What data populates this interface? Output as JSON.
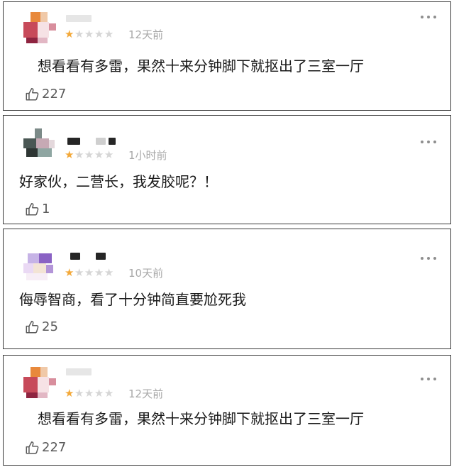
{
  "colors": {
    "star_active": "#f3a93a",
    "star_inactive": "#d6d6d6",
    "timestamp": "#a9a9a9",
    "border": "#3a3a3a"
  },
  "icons": {
    "rating": "star-icon",
    "more": "more-dots-icon",
    "like": "thumbs-up-icon"
  },
  "comments": [
    {
      "rating": 1,
      "max_rating": 5,
      "time": "12天前",
      "text": "想看看有多雷，果然十来分钟脚下就抠出了三室一厅",
      "likes": "227"
    },
    {
      "rating": 1,
      "max_rating": 5,
      "time": "1小时前",
      "text": "好家伙，二营长，我发胶呢？！",
      "likes": "1"
    },
    {
      "rating": 1,
      "max_rating": 5,
      "time": "10天前",
      "text": "侮辱智商，看了十分钟简直要尬死我",
      "likes": "25"
    },
    {
      "rating": 1,
      "max_rating": 5,
      "time": "12天前",
      "text": "想看看有多雷，果然十来分钟脚下就抠出了三室一厅",
      "likes": "227"
    }
  ]
}
